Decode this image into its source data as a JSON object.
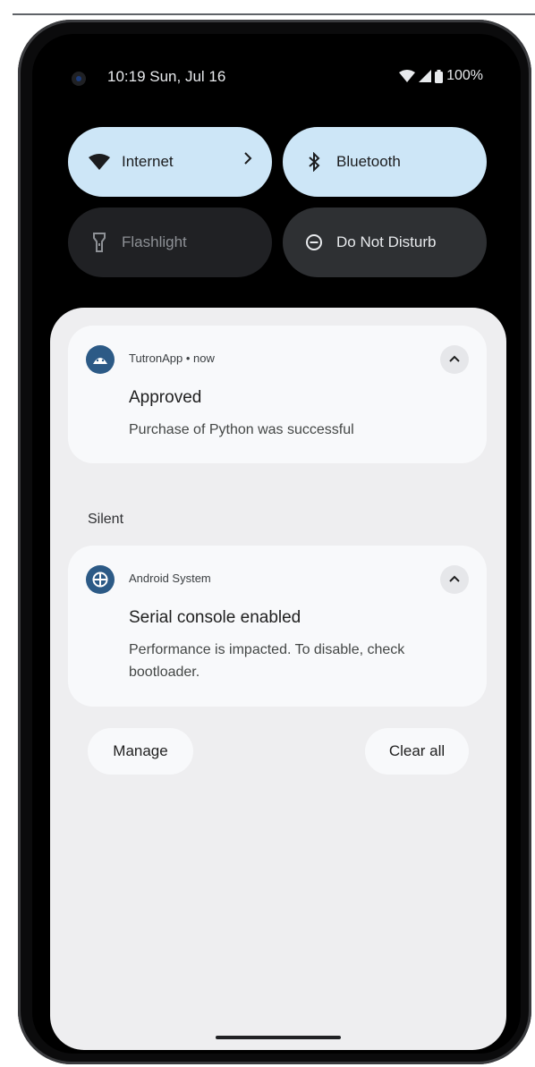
{
  "status_bar": {
    "time": "10:19 Sun, Jul 16",
    "battery": "100%"
  },
  "quick_settings": {
    "internet": "Internet",
    "bluetooth": "Bluetooth",
    "flashlight": "Flashlight",
    "dnd": "Do Not Disturb"
  },
  "notifications": [
    {
      "app": "TutronApp",
      "separator": "•",
      "time": "now",
      "title": "Approved",
      "body": "Purchase of Python was successful"
    },
    {
      "app": "Android System",
      "title": "Serial console enabled",
      "body": "Performance is impacted. To disable, check bootloader."
    }
  ],
  "sections": {
    "silent": "Silent"
  },
  "actions": {
    "manage": "Manage",
    "clear_all": "Clear all"
  },
  "colors": {
    "tile_active": "#cde6f7",
    "tile_inactive": "#202124",
    "shade": "#eeeef0",
    "app_icon": "#2c5a86"
  }
}
